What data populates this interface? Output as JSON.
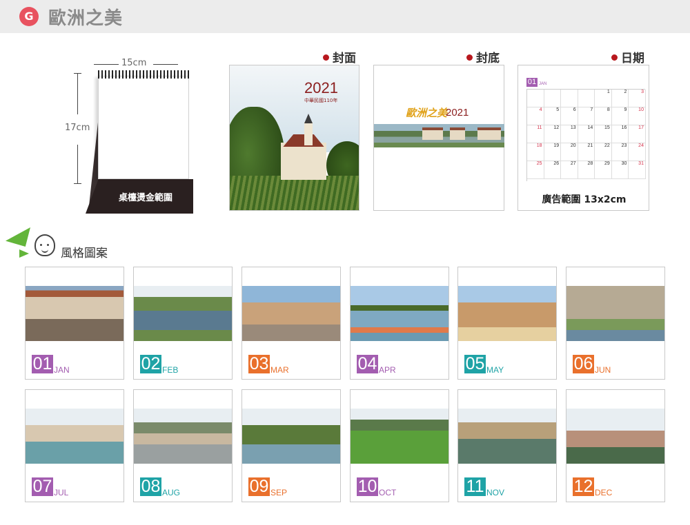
{
  "header": {
    "badge": "G",
    "title": "歐洲之美"
  },
  "desk": {
    "width_label": "15cm",
    "height_label": "17cm",
    "base_text": "桌檯燙金範圍"
  },
  "sections": {
    "cover": "封面",
    "back": "封底",
    "date": "日期"
  },
  "cover": {
    "year": "2021",
    "sub": "中華民國110年"
  },
  "back": {
    "logo": "歐洲之美",
    "year": "2021"
  },
  "datepanel": {
    "month_num": "01",
    "month_name": "JAN",
    "rows": [
      [
        "",
        "",
        "",
        "",
        "1",
        "2",
        "3"
      ],
      [
        "4",
        "5",
        "6",
        "7",
        "8",
        "9",
        "10"
      ],
      [
        "11",
        "12",
        "13",
        "14",
        "15",
        "16",
        "17"
      ],
      [
        "18",
        "19",
        "20",
        "21",
        "22",
        "23",
        "24"
      ],
      [
        "25",
        "26",
        "27",
        "28",
        "29",
        "30",
        "31"
      ]
    ],
    "caption": "廣告範圍 13x2cm"
  },
  "style": {
    "title": "風格圖案"
  },
  "months": [
    {
      "num": "01",
      "name": "JAN",
      "color": "#a35db0"
    },
    {
      "num": "02",
      "name": "FEB",
      "color": "#1fa3a6"
    },
    {
      "num": "03",
      "name": "MAR",
      "color": "#e9702c"
    },
    {
      "num": "04",
      "name": "APR",
      "color": "#a35db0"
    },
    {
      "num": "05",
      "name": "MAY",
      "color": "#1fa3a6"
    },
    {
      "num": "06",
      "name": "JUN",
      "color": "#e9702c"
    },
    {
      "num": "07",
      "name": "JUL",
      "color": "#a35db0"
    },
    {
      "num": "08",
      "name": "AUG",
      "color": "#1fa3a6"
    },
    {
      "num": "09",
      "name": "SEP",
      "color": "#e9702c"
    },
    {
      "num": "10",
      "name": "OCT",
      "color": "#a35db0"
    },
    {
      "num": "11",
      "name": "NOV",
      "color": "#1fa3a6"
    },
    {
      "num": "12",
      "name": "DEC",
      "color": "#e9702c"
    }
  ]
}
